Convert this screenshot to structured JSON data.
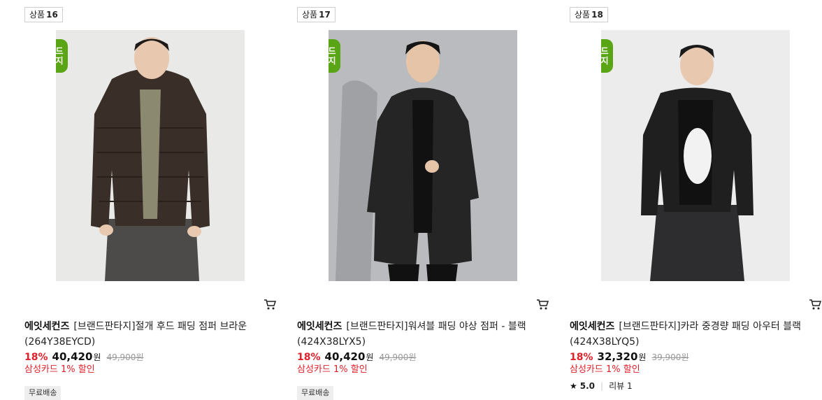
{
  "products": [
    {
      "badge_prefix": "상품",
      "badge_num": "16",
      "logo_line1": "브랜드",
      "logo_line2": "판타지",
      "brand": "에잇세컨즈",
      "name": "[브랜드판타지]절개 후드 패딩 점퍼 브라운 (264Y38EYCD)",
      "discount": "18%",
      "price": "40,420",
      "won": "원",
      "original_price": "49,900원",
      "card_discount": "삼성카드 1% 할인",
      "shipping": "무료배송",
      "bg": "#e9e9e7"
    },
    {
      "badge_prefix": "상품",
      "badge_num": "17",
      "logo_line1": "브랜드",
      "logo_line2": "판타지",
      "brand": "에잇세컨즈",
      "name": "[브랜드판타지]워셔블 패딩 야상 점퍼 - 블랙 (424X38LYX5)",
      "discount": "18%",
      "price": "40,420",
      "won": "원",
      "original_price": "49,900원",
      "card_discount": "삼성카드 1% 할인",
      "shipping": "무료배송",
      "bg": "#b9bbbe"
    },
    {
      "badge_prefix": "상품",
      "badge_num": "18",
      "logo_line1": "브랜드",
      "logo_line2": "판타지",
      "brand": "에잇세컨즈",
      "name": "[브랜드판타지]카라 중경량 패딩 아우터 블랙 (424X38LYQ5)",
      "discount": "18%",
      "price": "32,320",
      "won": "원",
      "original_price": "39,900원",
      "card_discount": "삼성카드 1% 할인",
      "rating": "5.0",
      "review_label": "리뷰 1",
      "bg": "#ececec"
    }
  ],
  "colors": {
    "discount_red": "#e0202a",
    "logo_green": "#5aa516"
  }
}
